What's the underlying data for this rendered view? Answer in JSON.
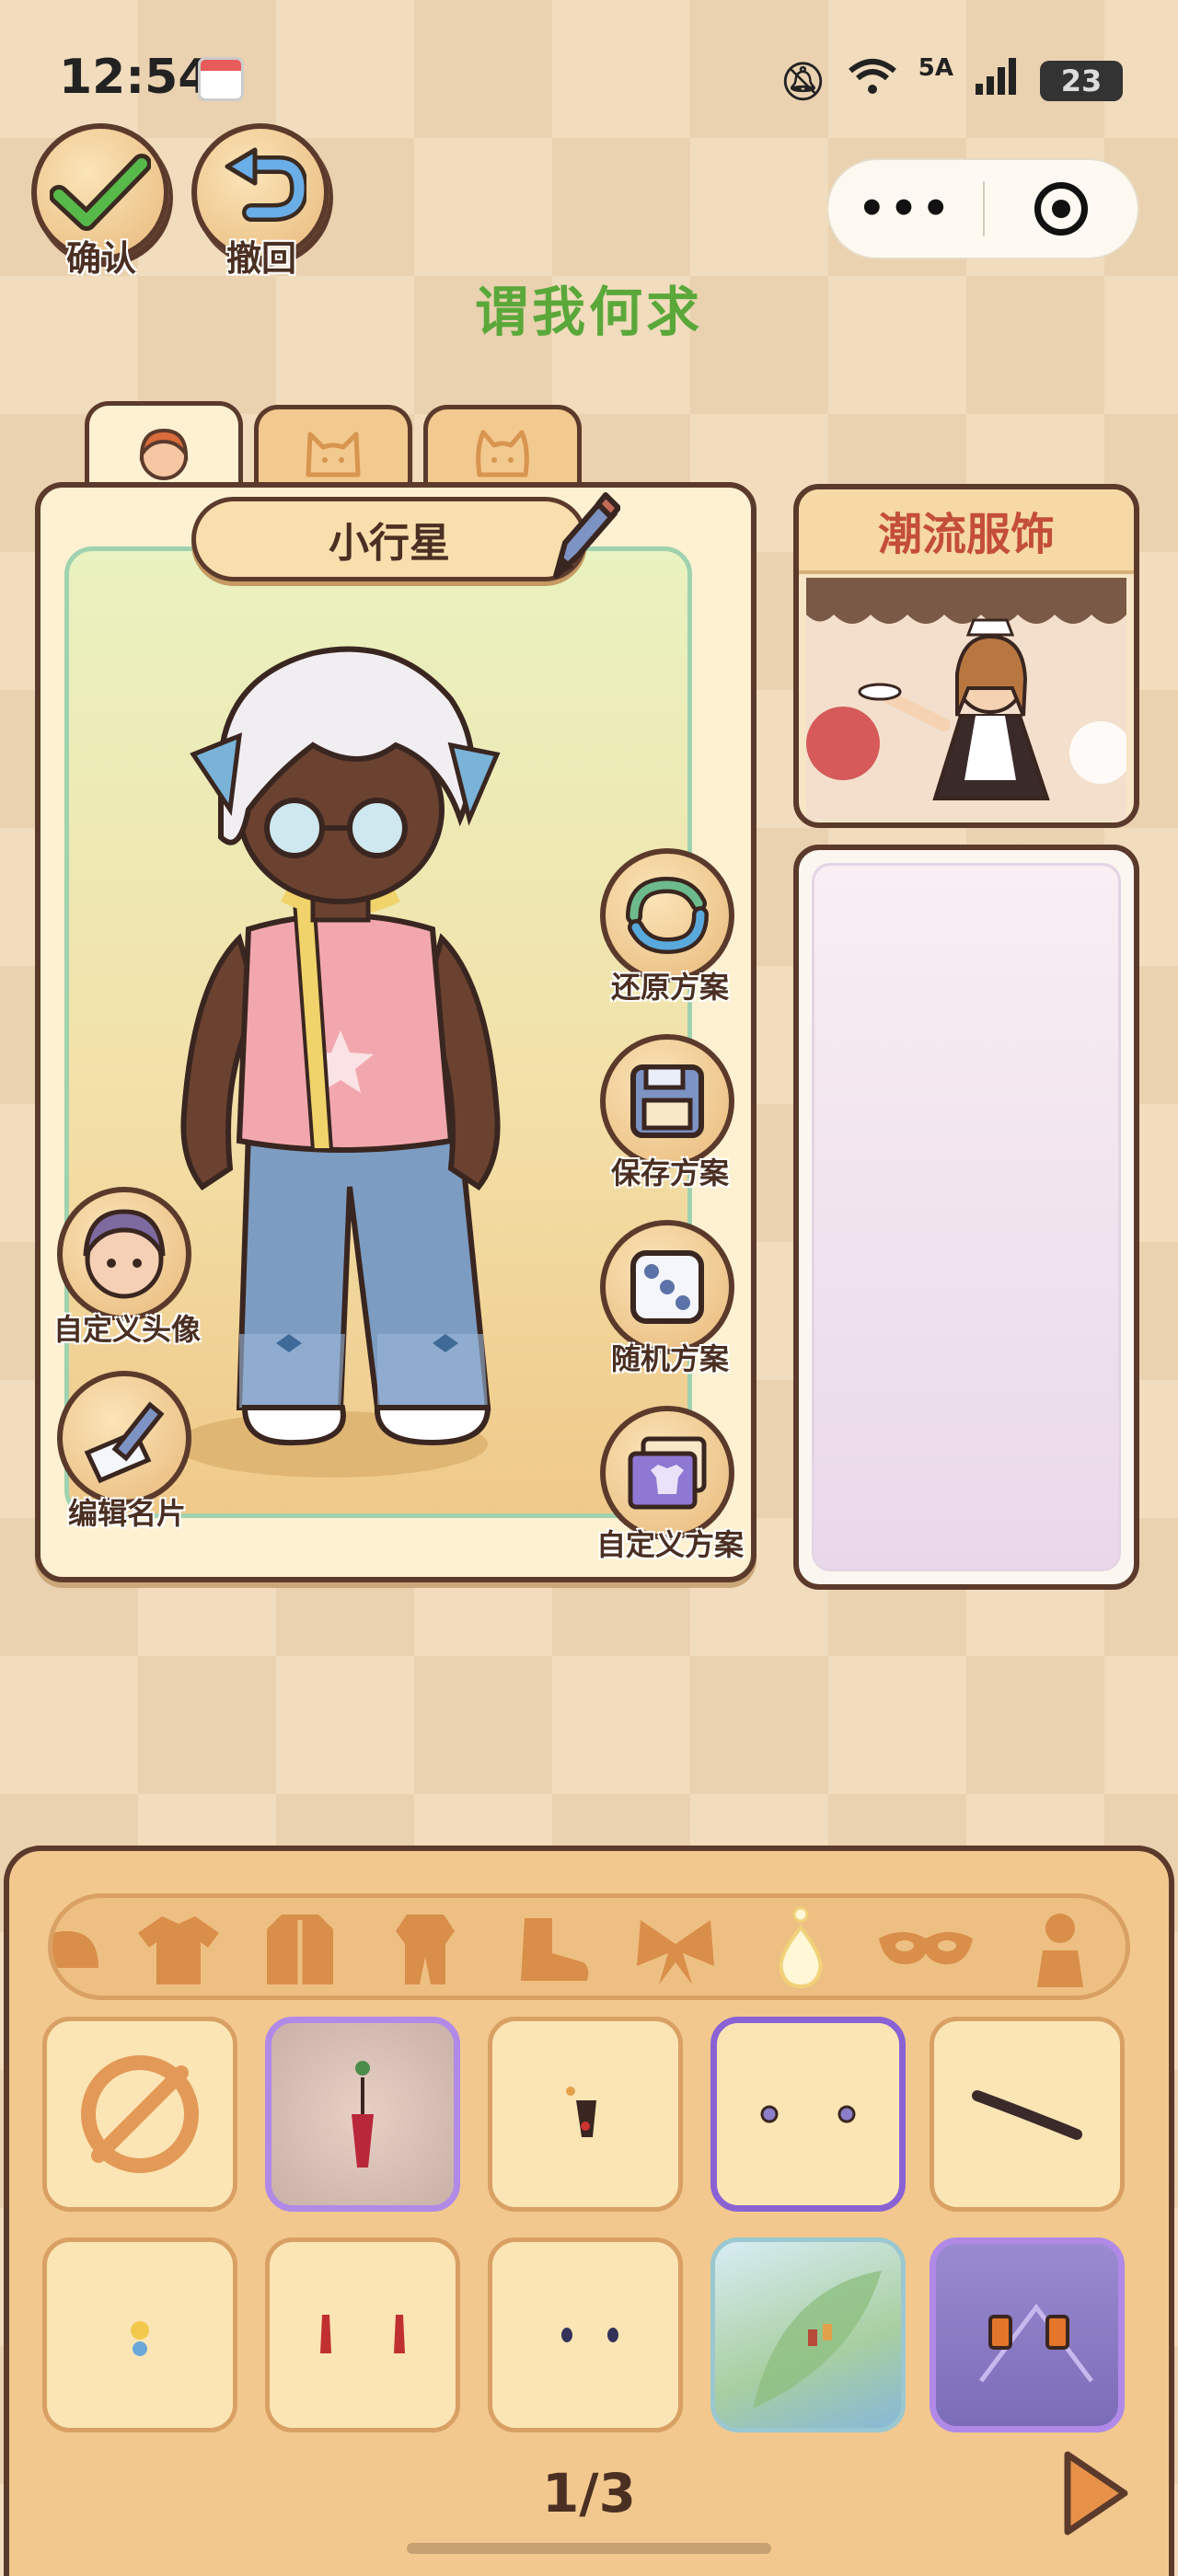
{
  "status_bar": {
    "time": "12:54",
    "network": "5A",
    "battery": "23"
  },
  "top_buttons": {
    "confirm_label": "确认",
    "undo_label": "撤回"
  },
  "capsule": {
    "more_label": "•••"
  },
  "page_title": "谓我何求",
  "character": {
    "name": "小行星"
  },
  "side_actions": {
    "restore": "还原方案",
    "save": "保存方案",
    "random": "随机方案",
    "custom": "自定义方案",
    "custom_avatar": "自定义头像",
    "edit_card": "编辑名片"
  },
  "fashion_card": {
    "title": "潮流服饰"
  },
  "wardrobe": {
    "categories": [
      "hat-icon",
      "shirt-icon",
      "coat-icon",
      "outfit-icon",
      "shoe-icon",
      "bow-icon",
      "earring-icon",
      "mask-icon",
      "figure-icon"
    ],
    "selected_category": "earring-icon",
    "page": "1/3"
  },
  "colors": {
    "accent_green": "#5aa83a",
    "title_red": "#c44e3a",
    "outline": "#5b3a2c",
    "selection_purple": "#8a62d4"
  }
}
